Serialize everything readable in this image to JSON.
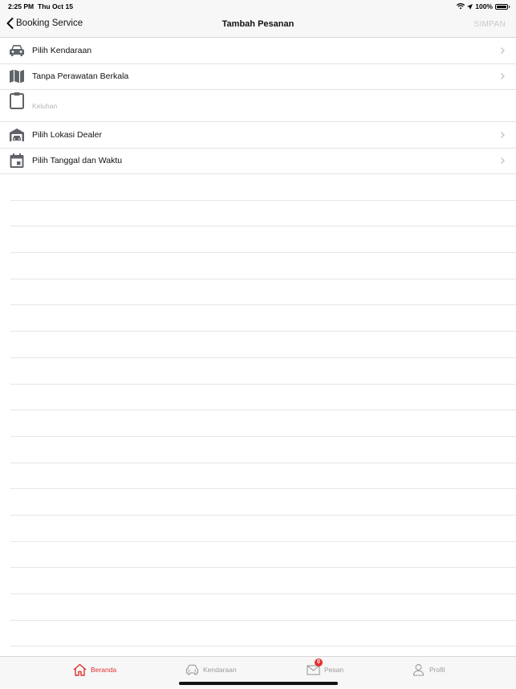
{
  "status_bar": {
    "time": "2:25 PM",
    "date": "Thu Oct 15",
    "battery": "100%"
  },
  "nav": {
    "back_label": "Booking Service",
    "title": "Tambah Pesanan",
    "save_label": "SIMPAN"
  },
  "rows": {
    "vehicle": "Pilih Kendaraan",
    "maintenance": "Tanpa Perawatan Berkala",
    "complaint_placeholder": "Keluhan",
    "dealer": "Pilih Lokasi Dealer",
    "datetime": "Pilih Tanggal dan Waktu"
  },
  "tabs": [
    {
      "label": "Beranda",
      "icon": "home-icon",
      "active": true
    },
    {
      "label": "Kendaraan",
      "icon": "car-icon",
      "active": false
    },
    {
      "label": "Pesan",
      "icon": "mail-icon",
      "active": false,
      "badge": "0"
    },
    {
      "label": "Profil",
      "icon": "person-icon",
      "active": false
    }
  ],
  "colors": {
    "accent": "#e0312f",
    "icon_gray": "#5f6368",
    "disabled": "#c9c9c9"
  }
}
